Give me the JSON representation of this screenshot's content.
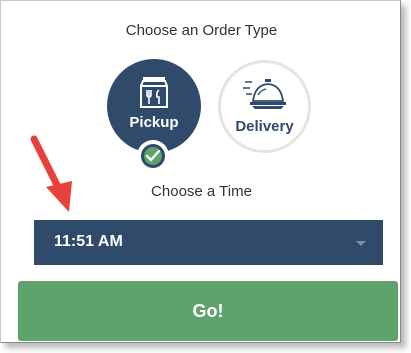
{
  "order_type": {
    "heading": "Choose an Order Type",
    "options": [
      {
        "label": "Pickup",
        "icon": "takeout-bag-icon",
        "selected": true
      },
      {
        "label": "Delivery",
        "icon": "cloche-icon",
        "selected": false
      }
    ]
  },
  "time": {
    "heading": "Choose a Time",
    "selected_value": "11:51 AM"
  },
  "submit": {
    "label": "Go!"
  },
  "colors": {
    "navy": "#2f4a6b",
    "green": "#5fa36c",
    "annotation_arrow": "#e8413c"
  }
}
